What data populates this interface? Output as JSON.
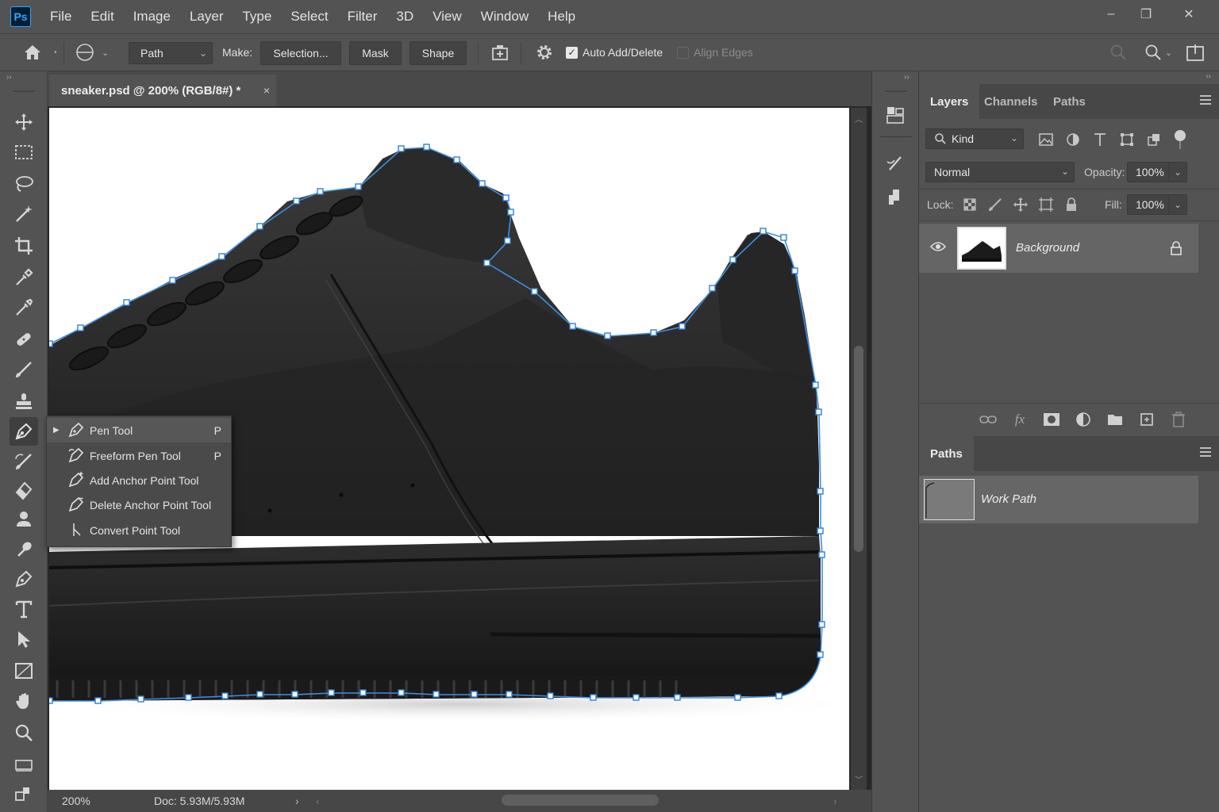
{
  "app": {
    "logo": "Ps"
  },
  "menubar": {
    "items": [
      "File",
      "Edit",
      "Image",
      "Layer",
      "Type",
      "Select",
      "Filter",
      "3D",
      "View",
      "Window",
      "Help"
    ]
  },
  "window_controls": {
    "minimize": "–",
    "restore": "❐",
    "close": "✕"
  },
  "options": {
    "mode_value": "Path",
    "make_label": "Make:",
    "selection_btn": "Selection...",
    "mask_btn": "Mask",
    "shape_btn": "Shape",
    "auto_add_delete_label": "Auto Add/Delete",
    "auto_add_delete_checked": true,
    "align_edges_label": "Align Edges",
    "align_edges_checked": false
  },
  "document": {
    "tab_title": "sneaker.psd @ 200% (RGB/8#) *",
    "close_glyph": "×",
    "zoom": "200%",
    "doc_info": "Doc: 5.93M/5.93M"
  },
  "toolbar": {
    "tools": [
      "move-tool",
      "rectangular-marquee-tool",
      "lasso-tool",
      "magic-wand-tool",
      "crop-tool",
      "eyedropper-tool",
      "spot-healing-brush-tool",
      "patch-tool",
      "brush-tool",
      "clone-stamp-tool",
      "pen-tool",
      "history-brush-tool",
      "eraser-tool",
      "blur-tool",
      "dodge-tool",
      "pen-tool-2",
      "type-tool",
      "path-selection-tool",
      "rectangle-tool",
      "hand-tool",
      "zoom-tool",
      "edit-toolbar",
      "foreground-background-colors"
    ],
    "active_tool": "pen-tool"
  },
  "flyout": {
    "items": [
      {
        "label": "Pen Tool",
        "shortcut": "P",
        "selected": true
      },
      {
        "label": "Freeform Pen Tool",
        "shortcut": "P",
        "selected": false
      },
      {
        "label": "Add Anchor Point Tool",
        "shortcut": "",
        "selected": false
      },
      {
        "label": "Delete Anchor Point Tool",
        "shortcut": "",
        "selected": false
      },
      {
        "label": "Convert Point Tool",
        "shortcut": "",
        "selected": false
      }
    ]
  },
  "layers_panel": {
    "tabs": [
      "Layers",
      "Channels",
      "Paths"
    ],
    "active_tab": "Layers",
    "filter_kind": "Kind",
    "blend_mode": "Normal",
    "opacity_label": "Opacity:",
    "opacity_value": "100%",
    "lock_label": "Lock:",
    "fill_label": "Fill:",
    "fill_value": "100%",
    "layers": [
      {
        "name": "Background",
        "visible": true,
        "locked": true
      }
    ]
  },
  "paths_panel": {
    "tab": "Paths",
    "paths": [
      {
        "name": "Work Path"
      }
    ]
  },
  "colors": {
    "accent": "#31a8ff",
    "path_stroke": "#3d8fe0",
    "ui_bg": "#535353",
    "panel_dark": "#474747",
    "selected_row": "#656565"
  }
}
